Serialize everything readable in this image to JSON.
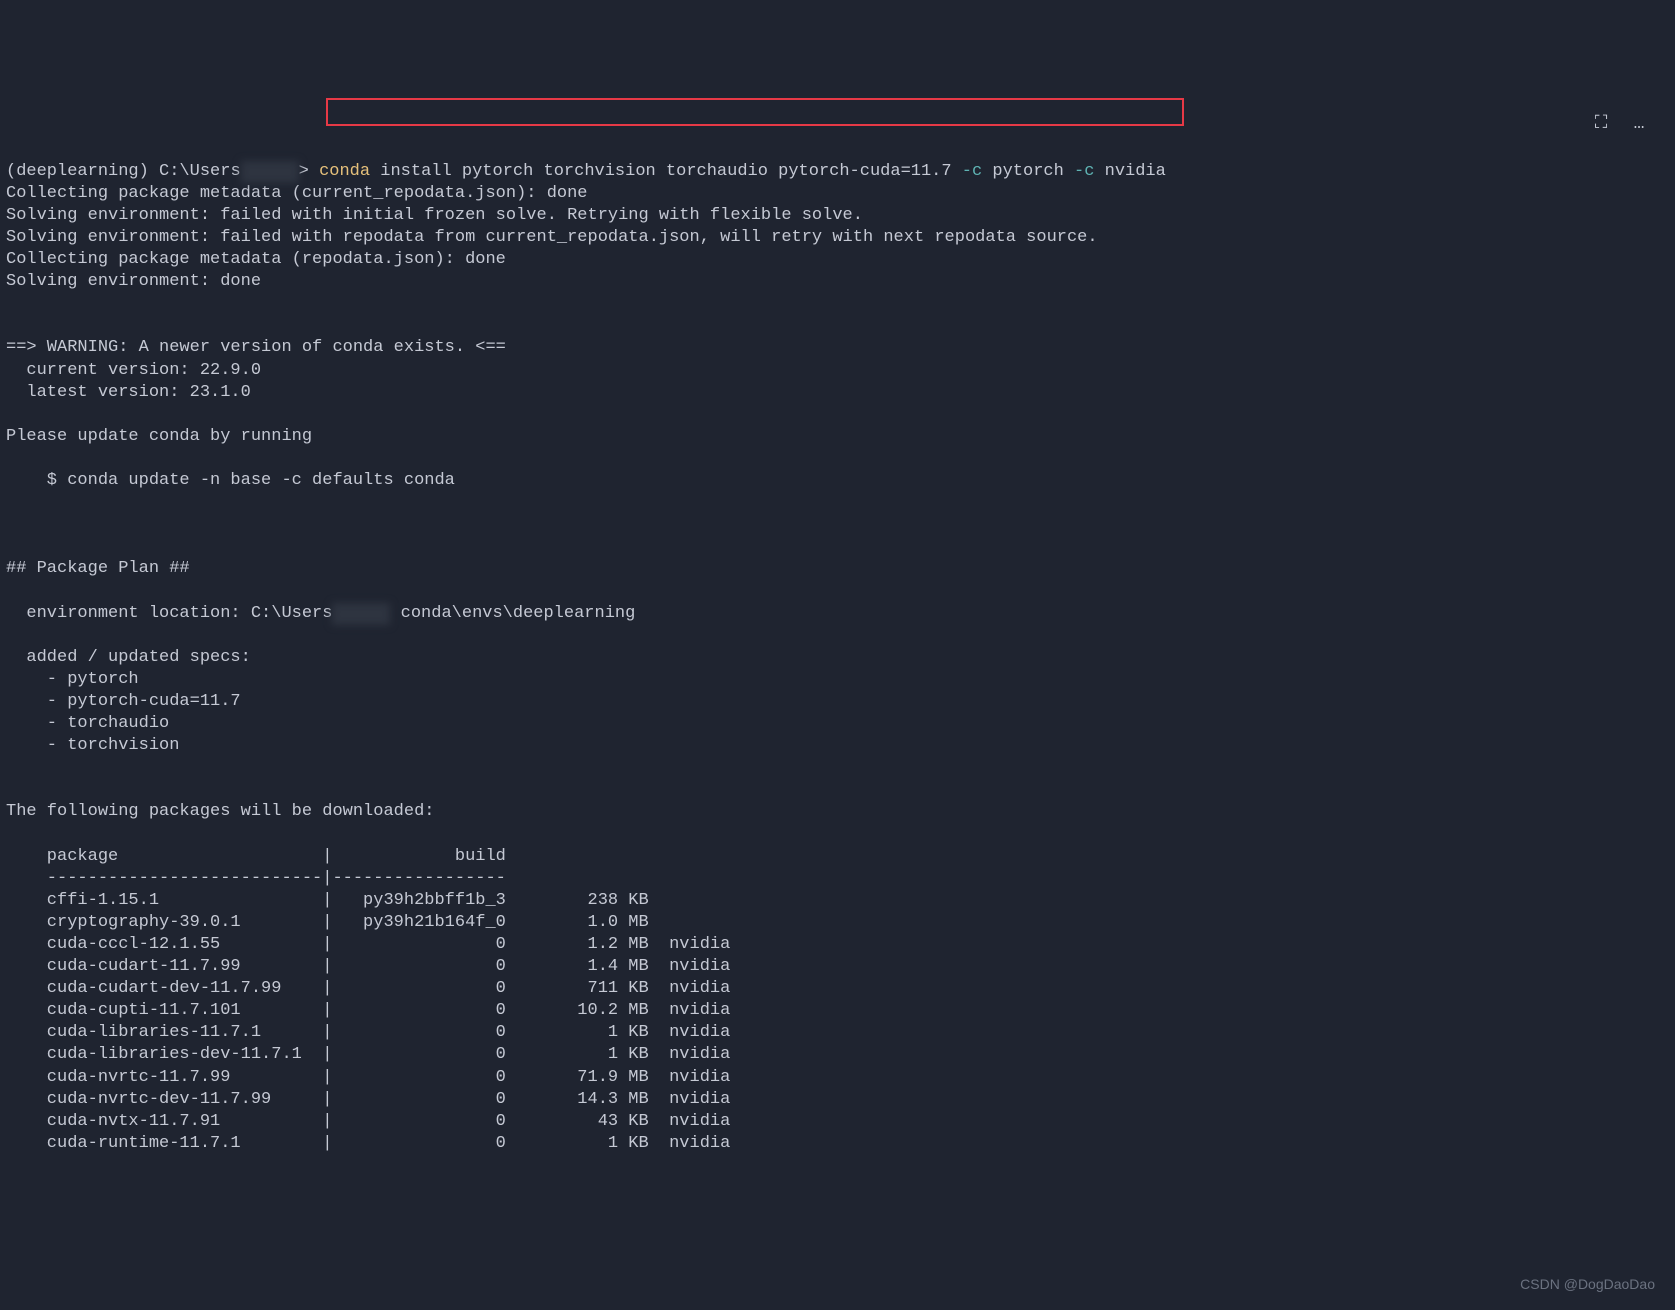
{
  "prompt": {
    "env": "(deeplearning)",
    "path_prefix": "C:\\Users",
    "redacted": "█████",
    "path_suffix": ">"
  },
  "command": {
    "conda": "conda",
    "rest": "install pytorch torchvision torchaudio pytorch-cuda=11.7",
    "flag1": "-c",
    "arg1": "pytorch",
    "flag2": "-c",
    "arg2": "nvidia"
  },
  "toolbar": {
    "expand": "⛶",
    "more": "…"
  },
  "output": {
    "line1": "Collecting package metadata (current_repodata.json): done",
    "line2": "Solving environment: failed with initial frozen solve. Retrying with flexible solve.",
    "line3": "Solving environment: failed with repodata from current_repodata.json, will retry with next repodata source.",
    "line4": "Collecting package metadata (repodata.json): done",
    "line5": "Solving environment: done",
    "warn_header": "==> WARNING: A newer version of conda exists. <==",
    "warn_current": "  current version: 22.9.0",
    "warn_latest": "  latest version: 23.1.0",
    "update_prompt": "Please update conda by running",
    "update_cmd": "    $ conda update -n base -c defaults conda",
    "plan_header": "## Package Plan ##",
    "env_loc_prefix": "  environment location: C:\\Users",
    "env_loc_suffix": "conda\\envs\\deeplearning",
    "specs_header": "  added / updated specs:",
    "specs": [
      "    - pytorch",
      "    - pytorch-cuda=11.7",
      "    - torchaudio",
      "    - torchvision"
    ],
    "dl_header": "The following packages will be downloaded:",
    "table_header_pkg": "    package                    |            build",
    "table_divider": "    ---------------------------|-----------------"
  },
  "packages": [
    {
      "name": "cffi-1.15.1",
      "build": "py39h2bbff1b_3",
      "size": "238 KB",
      "channel": ""
    },
    {
      "name": "cryptography-39.0.1",
      "build": "py39h21b164f_0",
      "size": "1.0 MB",
      "channel": ""
    },
    {
      "name": "cuda-cccl-12.1.55",
      "build": "0",
      "size": "1.2 MB",
      "channel": "nvidia"
    },
    {
      "name": "cuda-cudart-11.7.99",
      "build": "0",
      "size": "1.4 MB",
      "channel": "nvidia"
    },
    {
      "name": "cuda-cudart-dev-11.7.99",
      "build": "0",
      "size": "711 KB",
      "channel": "nvidia"
    },
    {
      "name": "cuda-cupti-11.7.101",
      "build": "0",
      "size": "10.2 MB",
      "channel": "nvidia"
    },
    {
      "name": "cuda-libraries-11.7.1",
      "build": "0",
      "size": "1 KB",
      "channel": "nvidia"
    },
    {
      "name": "cuda-libraries-dev-11.7.1",
      "build": "0",
      "size": "1 KB",
      "channel": "nvidia"
    },
    {
      "name": "cuda-nvrtc-11.7.99",
      "build": "0",
      "size": "71.9 MB",
      "channel": "nvidia"
    },
    {
      "name": "cuda-nvrtc-dev-11.7.99",
      "build": "0",
      "size": "14.3 MB",
      "channel": "nvidia"
    },
    {
      "name": "cuda-nvtx-11.7.91",
      "build": "0",
      "size": "43 KB",
      "channel": "nvidia"
    },
    {
      "name": "cuda-runtime-11.7.1",
      "build": "0",
      "size": "1 KB",
      "channel": "nvidia"
    }
  ],
  "watermark": "CSDN @DogDaoDao"
}
